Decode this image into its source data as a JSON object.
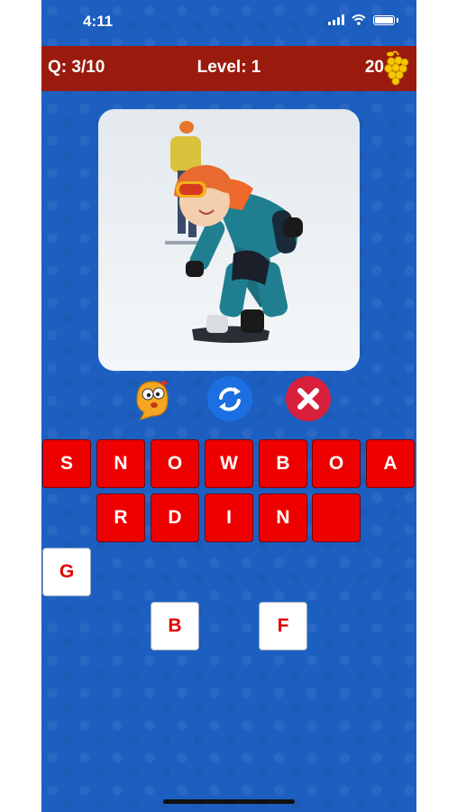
{
  "status": {
    "time": "4:11"
  },
  "header": {
    "question": "Q: 3/10",
    "level": "Level: 1",
    "coins": "20",
    "coin_icon": "grapes-icon"
  },
  "picture": {
    "subject": "child snowboarding"
  },
  "actions": [
    {
      "name": "hint",
      "icon": "emoji-speech-icon"
    },
    {
      "name": "shuffle",
      "icon": "refresh-icon"
    },
    {
      "name": "remove",
      "icon": "close-icon"
    }
  ],
  "answer": {
    "row1": [
      "S",
      "N",
      "O",
      "W",
      "B",
      "O",
      "A"
    ],
    "row2": [
      "R",
      "D",
      "I",
      "N",
      ""
    ]
  },
  "letters": {
    "row1": [
      "G",
      "",
      "",
      "",
      "",
      "",
      ""
    ],
    "row2": [
      "",
      "",
      "B",
      "",
      "F",
      "",
      ""
    ]
  },
  "colors": {
    "background": "#1d5fc0",
    "header": "#9a1b0e",
    "answer_tile": "#ef0000",
    "letter_text": "#e00000"
  }
}
